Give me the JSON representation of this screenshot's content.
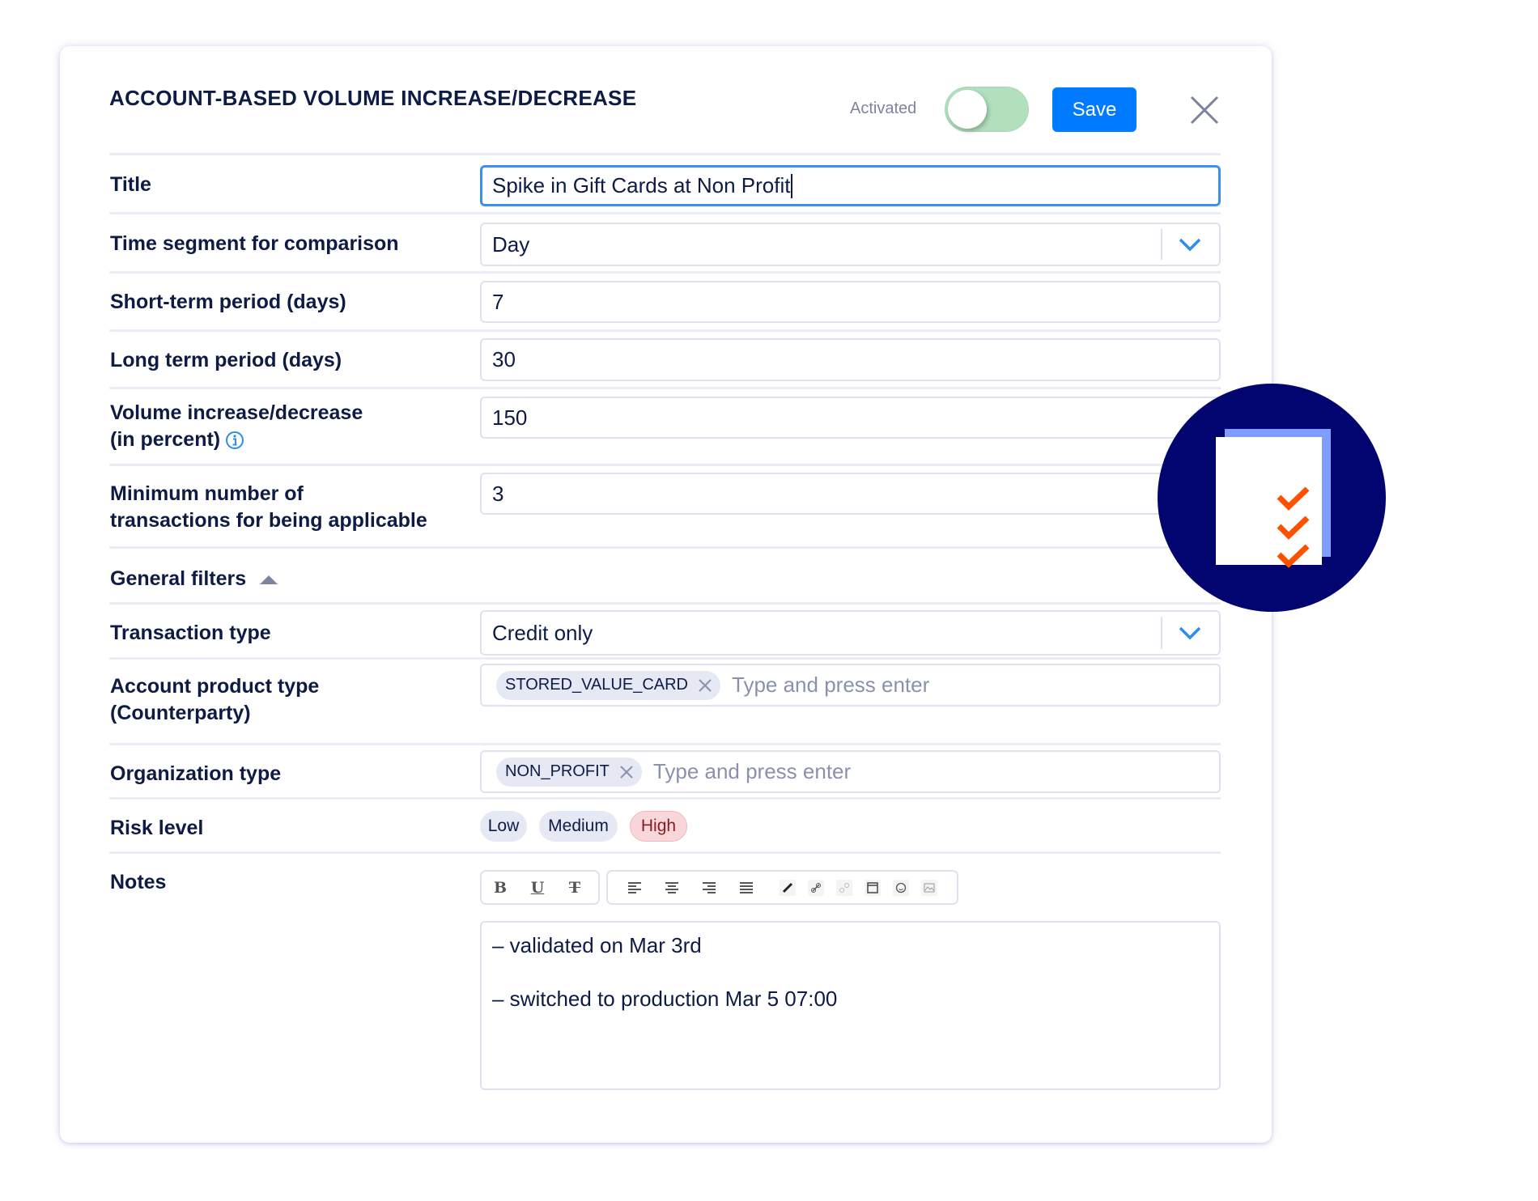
{
  "dialog": {
    "title": "ACCOUNT-BASED VOLUME INCREASE/DECREASE",
    "activated_label": "Activated",
    "activated": true,
    "save_label": "Save",
    "close_icon": "close-icon"
  },
  "fields": {
    "title": {
      "label": "Title",
      "value": "Spike in Gift Cards at Non Profit"
    },
    "time_segment": {
      "label": "Time segment for comparison",
      "value": "Day"
    },
    "short_term": {
      "label": "Short-term period (days)",
      "value": "7"
    },
    "long_term": {
      "label": "Long term period (days)",
      "value": "30"
    },
    "volume": {
      "label_line1": "Volume increase/decrease",
      "label_line2": "(in percent)",
      "value": "150",
      "info_icon": "info-icon"
    },
    "min_tx": {
      "label_line1": "Minimum number of",
      "label_line2": "transactions for being applicable",
      "value": "3"
    }
  },
  "general_filters": {
    "label": "General filters",
    "expanded": true,
    "transaction_type": {
      "label": "Transaction type",
      "value": "Credit only"
    },
    "account_product_type": {
      "label_line1": "Account product type",
      "label_line2": "(Counterparty)",
      "tags": [
        "STORED_VALUE_CARD"
      ],
      "placeholder": "Type and press enter"
    },
    "organization_type": {
      "label": "Organization type",
      "tags": [
        "NON_PROFIT"
      ],
      "placeholder": "Type and press enter"
    },
    "risk_level": {
      "label": "Risk level",
      "options": [
        "Low",
        "Medium",
        "High"
      ],
      "selected": "High"
    }
  },
  "notes": {
    "label": "Notes",
    "toolbar": {
      "format": [
        "bold",
        "underline",
        "strikethrough"
      ],
      "align": [
        "align-left",
        "align-center",
        "align-right",
        "align-justify"
      ],
      "insert": [
        "brush",
        "link",
        "unlink",
        "embed",
        "emoji",
        "image"
      ]
    },
    "lines": [
      "– validated on Mar 3rd",
      "– switched to production Mar 5 07:00"
    ]
  },
  "decoration": {
    "icon": "checklist-document-icon",
    "circle_color": "#020570",
    "check_color": "#ff5000"
  }
}
